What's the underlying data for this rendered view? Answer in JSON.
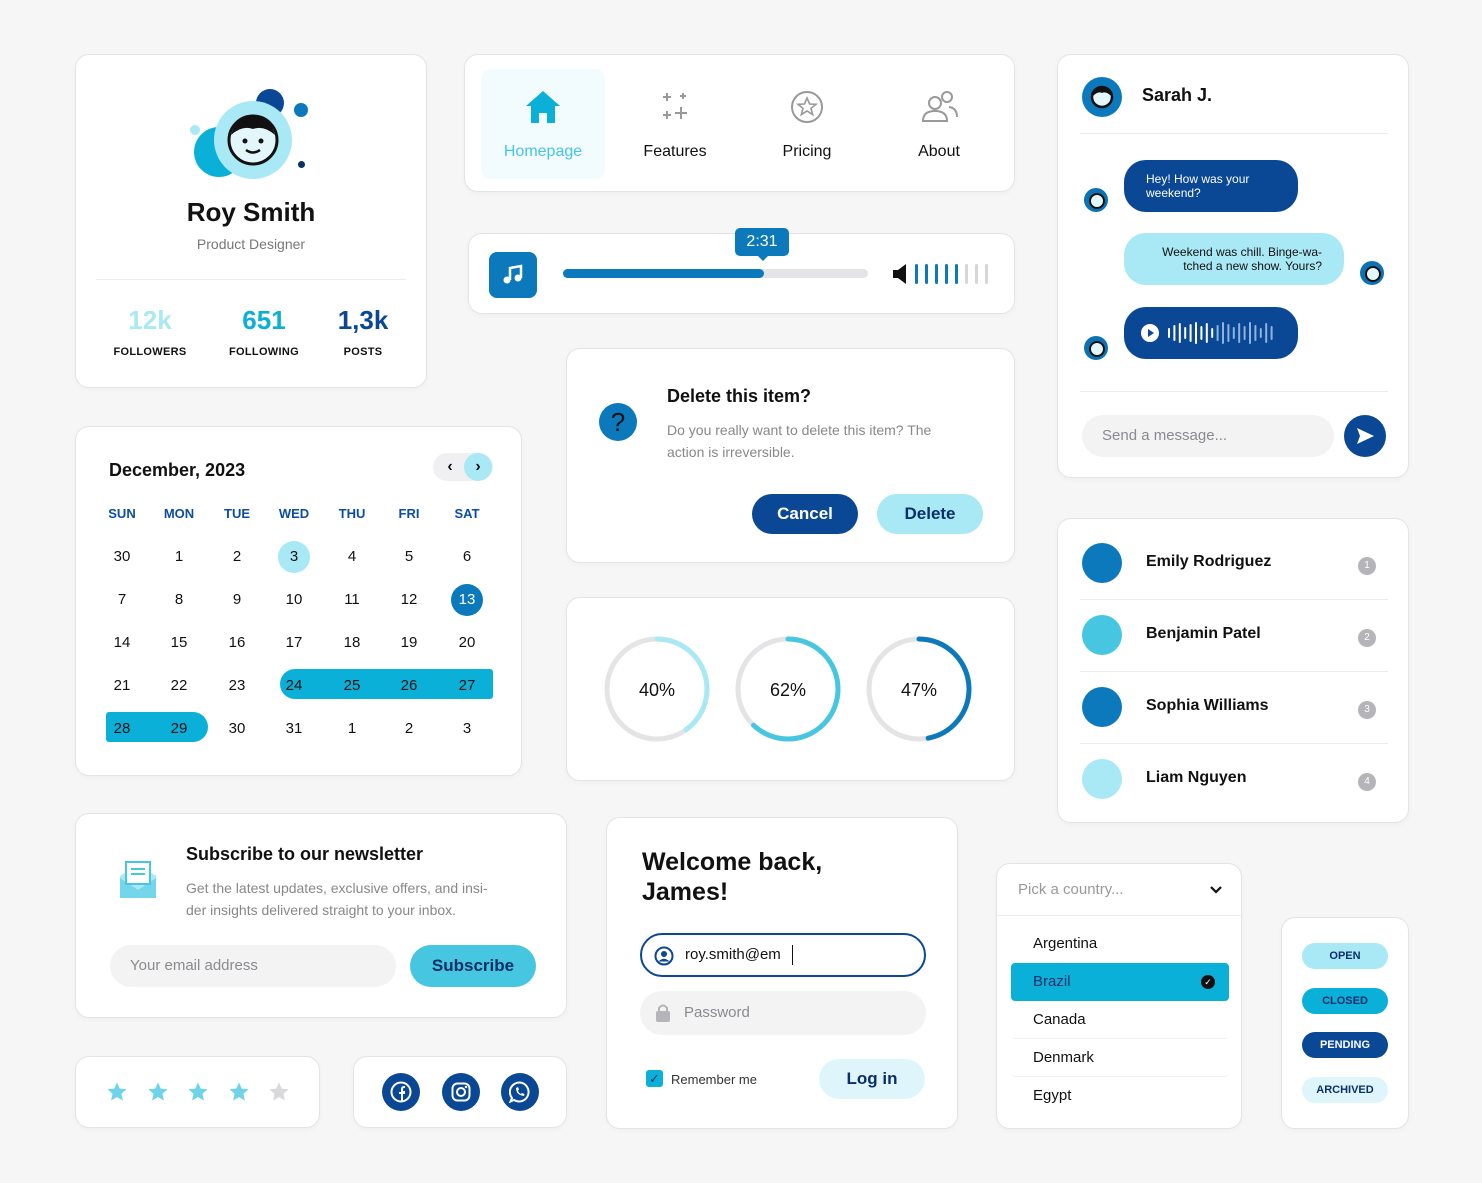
{
  "colors": {
    "dark_blue": "#0a4795",
    "mid_blue": "#0b79bb",
    "cyan": "#47c6e2",
    "light_cyan": "#a9e8f5",
    "pale": "#def6fb"
  },
  "profile": {
    "name": "Roy Smith",
    "role": "Product Designer",
    "stats": [
      {
        "value": "12k",
        "label": "FOLLOWERS"
      },
      {
        "value": "651",
        "label": "FOLLOWING"
      },
      {
        "value": "1,3k",
        "label": "POSTS"
      }
    ]
  },
  "nav": {
    "items": [
      {
        "label": "Homepage",
        "icon": "home-icon",
        "active": true
      },
      {
        "label": "Features",
        "icon": "sparkles-icon"
      },
      {
        "label": "Pricing",
        "icon": "star-badge-icon"
      },
      {
        "label": "About",
        "icon": "users-icon"
      }
    ]
  },
  "player": {
    "time": "2:31",
    "progress": 0.66,
    "volume_bars": 5,
    "volume_total": 8,
    "icon": "music-note-icon"
  },
  "dialog": {
    "title": "Delete this item?",
    "body_line1": "Do you really want to delete this item? The",
    "body_line2": "action is irreversible.",
    "cancel": "Cancel",
    "confirm": "Delete",
    "icon": "question-icon"
  },
  "calendar": {
    "title": "December, 2023",
    "weekdays": [
      "SUN",
      "MON",
      "TUE",
      "WED",
      "THU",
      "FRI",
      "SAT"
    ],
    "weeks": [
      [
        "30",
        "1",
        "2",
        "3",
        "4",
        "5",
        "6"
      ],
      [
        "7",
        "8",
        "9",
        "10",
        "11",
        "12",
        "13"
      ],
      [
        "14",
        "15",
        "16",
        "17",
        "18",
        "19",
        "20"
      ],
      [
        "21",
        "22",
        "23",
        "24",
        "25",
        "26",
        "27"
      ],
      [
        "28",
        "29",
        "30",
        "31",
        "1",
        "2",
        "3"
      ]
    ]
  },
  "progress_rings": [
    {
      "label": "40%",
      "value": 0.4,
      "color": "#a9e8f5"
    },
    {
      "label": "62%",
      "value": 0.62,
      "color": "#47c6e2"
    },
    {
      "label": "47%",
      "value": 0.47,
      "color": "#0b79bb"
    }
  ],
  "chat": {
    "name": "Sarah J.",
    "messages": [
      {
        "line1": "Hey! How was your",
        "line2": "weekend?"
      },
      {
        "line1": "Weekend was chill. Binge-wa-",
        "line2": "tched a new show. Yours?"
      }
    ],
    "placeholder": "Send a message...",
    "send_icon": "send-icon"
  },
  "users": [
    {
      "name": "Emily Rodriguez",
      "badge": "1",
      "color": "#0b79bb"
    },
    {
      "name": "Benjamin Patel",
      "badge": "2",
      "color": "#47c6e2"
    },
    {
      "name": "Sophia Williams",
      "badge": "3",
      "color": "#0b79bb"
    },
    {
      "name": "Liam Nguyen",
      "badge": "4",
      "color": "#a9e8f5"
    }
  ],
  "newsletter": {
    "title": "Subscribe to our newsletter",
    "body_line1": "Get the latest updates, exclusive offers, and insi-",
    "body_line2": "der insights delivered straight to your inbox.",
    "placeholder": "Your email address",
    "button": "Subscribe",
    "icon": "mail-icon"
  },
  "login": {
    "title_line1": "Welcome back,",
    "title_line2": "James!",
    "email_value": "roy.smith@em",
    "password_placeholder": "Password",
    "remember": "Remember me",
    "button": "Log in"
  },
  "country": {
    "placeholder": "Pick a country...",
    "options": [
      "Argentina",
      "Brazil",
      "Canada",
      "Denmark",
      "Egypt"
    ],
    "selected": "Brazil"
  },
  "statuses": [
    {
      "label": "OPEN",
      "bg": "#a9e8f5",
      "fg": "#0a2f6b"
    },
    {
      "label": "CLOSED",
      "bg": "#0bb0d8",
      "fg": "#0a2f6b"
    },
    {
      "label": "PENDING",
      "bg": "#0a4795",
      "fg": "#ffffff"
    },
    {
      "label": "ARCHIVED",
      "bg": "#def6fb",
      "fg": "#0a2f6b"
    }
  ],
  "rating": {
    "value": 4,
    "max": 5
  },
  "social": [
    "facebook-icon",
    "instagram-icon",
    "whatsapp-icon"
  ]
}
